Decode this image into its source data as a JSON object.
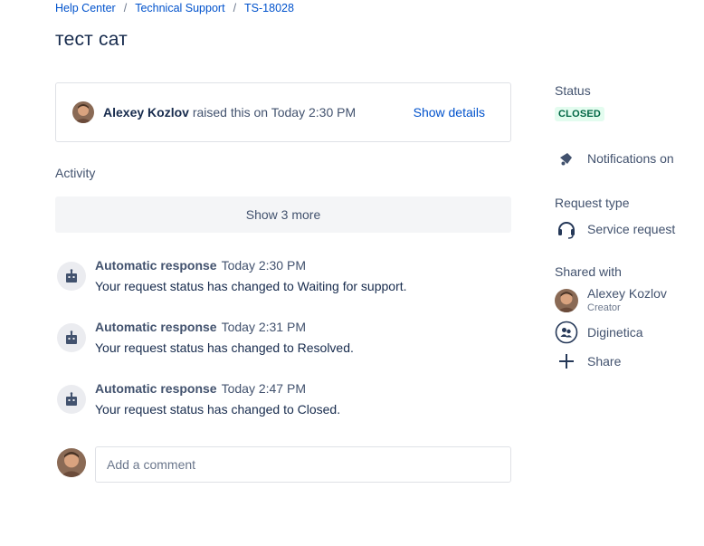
{
  "breadcrumb": {
    "items": [
      "Help Center",
      "Technical Support",
      "TS-18028"
    ],
    "separator": "/"
  },
  "request": {
    "title": "тест сат",
    "raised_by": "Alexey Kozlov",
    "raised_text": "raised this on Today 2:30 PM",
    "show_details_label": "Show details"
  },
  "activity": {
    "heading": "Activity",
    "show_more_label": "Show 3 more",
    "items": [
      {
        "author": "Automatic response",
        "time": "Today 2:30 PM",
        "message": "Your request status has changed to Waiting for support."
      },
      {
        "author": "Automatic response",
        "time": "Today 2:31 PM",
        "message": "Your request status has changed to Resolved."
      },
      {
        "author": "Automatic response",
        "time": "Today 2:47 PM",
        "message": "Your request status has changed to Closed."
      }
    ]
  },
  "comment": {
    "placeholder": "Add a comment"
  },
  "sidebar": {
    "status_label": "Status",
    "status_value": "CLOSED",
    "notifications_label": "Notifications on",
    "request_type_label": "Request type",
    "request_type_value": "Service request",
    "shared_with_label": "Shared with",
    "shared": [
      {
        "name": "Alexey Kozlov",
        "role": "Creator"
      },
      {
        "name": "Diginetica",
        "role": ""
      }
    ],
    "share_label": "Share"
  },
  "colors": {
    "link": "#0052cc",
    "status_bg": "#e3fcef",
    "status_text": "#006644",
    "muted": "#42526e"
  },
  "icons": {
    "notifications": "megaphone-icon",
    "request_type": "headset-icon",
    "organization": "organization-icon",
    "share": "plus-icon",
    "bot": "bot-icon"
  }
}
